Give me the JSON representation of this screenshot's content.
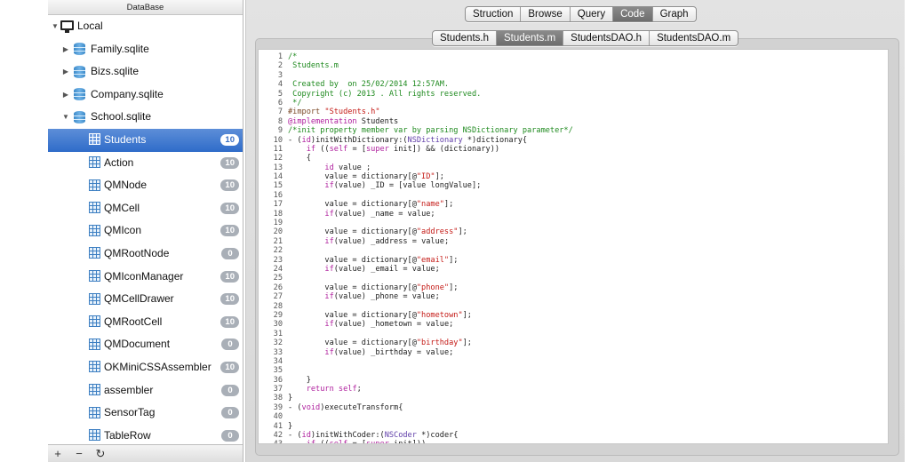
{
  "sidebar": {
    "header": "DataBase",
    "rows": [
      {
        "label": "Local",
        "kind": "monitor",
        "level": 0,
        "disclosure": "open"
      },
      {
        "label": "Family.sqlite",
        "kind": "db",
        "level": 1,
        "disclosure": "closed"
      },
      {
        "label": "Bizs.sqlite",
        "kind": "db",
        "level": 1,
        "disclosure": "closed"
      },
      {
        "label": "Company.sqlite",
        "kind": "db",
        "level": 1,
        "disclosure": "closed"
      },
      {
        "label": "School.sqlite",
        "kind": "db",
        "level": 1,
        "disclosure": "open"
      },
      {
        "label": "Students",
        "kind": "table",
        "level": 2,
        "badge": "10",
        "selected": true
      },
      {
        "label": "Action",
        "kind": "table",
        "level": 2,
        "badge": "10"
      },
      {
        "label": "QMNode",
        "kind": "table",
        "level": 2,
        "badge": "10"
      },
      {
        "label": "QMCell",
        "kind": "table",
        "level": 2,
        "badge": "10"
      },
      {
        "label": "QMIcon",
        "kind": "table",
        "level": 2,
        "badge": "10"
      },
      {
        "label": "QMRootNode",
        "kind": "table",
        "level": 2,
        "badge": "0"
      },
      {
        "label": "QMIconManager",
        "kind": "table",
        "level": 2,
        "badge": "10"
      },
      {
        "label": "QMCellDrawer",
        "kind": "table",
        "level": 2,
        "badge": "10"
      },
      {
        "label": "QMRootCell",
        "kind": "table",
        "level": 2,
        "badge": "10"
      },
      {
        "label": "QMDocument",
        "kind": "table",
        "level": 2,
        "badge": "0"
      },
      {
        "label": "OKMiniCSSAssembler",
        "kind": "table",
        "level": 2,
        "badge": "10"
      },
      {
        "label": "assembler",
        "kind": "table",
        "level": 2,
        "badge": "0"
      },
      {
        "label": "SensorTag",
        "kind": "table",
        "level": 2,
        "badge": "0"
      },
      {
        "label": "TableRow",
        "kind": "table",
        "level": 2,
        "badge": "0"
      }
    ],
    "footer": {
      "add": "+",
      "remove": "−",
      "refresh": "↻"
    }
  },
  "toolbar": {
    "modes": [
      {
        "label": "Struction",
        "active": false
      },
      {
        "label": "Browse",
        "active": false
      },
      {
        "label": "Query",
        "active": false
      },
      {
        "label": "Code",
        "active": true
      },
      {
        "label": "Graph",
        "active": false
      }
    ],
    "files": [
      {
        "label": "Students.h",
        "active": false
      },
      {
        "label": "Students.m",
        "active": true
      },
      {
        "label": "StudentsDAO.h",
        "active": false
      },
      {
        "label": "StudentsDAO.m",
        "active": false
      }
    ]
  },
  "code": {
    "lines": [
      [
        [
          "c",
          "/*"
        ]
      ],
      [
        [
          "c",
          " Students.m"
        ]
      ],
      [
        [
          "c",
          " "
        ]
      ],
      [
        [
          "c",
          " Created by  on 25/02/2014 12:57AM."
        ]
      ],
      [
        [
          "c",
          " Copyright (c) 2013 . All rights reserved."
        ]
      ],
      [
        [
          "c",
          " */"
        ]
      ],
      [
        [
          "p",
          "#import "
        ],
        [
          "s",
          "\"Students.h\""
        ]
      ],
      [
        [
          "k",
          "@implementation"
        ],
        [
          "n",
          " Students"
        ]
      ],
      [
        [
          "c",
          "/*init property member var by parsing NSDictionary parameter*/"
        ]
      ],
      [
        [
          "n",
          "- ("
        ],
        [
          "k",
          "id"
        ],
        [
          "n",
          ")initWithDictionary:("
        ],
        [
          "t",
          "NSDictionary"
        ],
        [
          "n",
          " *)dictionary{"
        ]
      ],
      [
        [
          "n",
          "    "
        ],
        [
          "k",
          "if"
        ],
        [
          "n",
          " (("
        ],
        [
          "k",
          "self"
        ],
        [
          "n",
          " = ["
        ],
        [
          "k",
          "super"
        ],
        [
          "n",
          " init]) && (dictionary))"
        ]
      ],
      [
        [
          "n",
          "    {"
        ]
      ],
      [
        [
          "n",
          "        "
        ],
        [
          "k",
          "id"
        ],
        [
          "n",
          " value ;"
        ]
      ],
      [
        [
          "n",
          "        value = dictionary[@"
        ],
        [
          "s",
          "\"ID\""
        ],
        [
          "n",
          "];"
        ]
      ],
      [
        [
          "n",
          "        "
        ],
        [
          "k",
          "if"
        ],
        [
          "n",
          "(value) _ID = [value longValue];"
        ]
      ],
      [
        [
          "n",
          ""
        ]
      ],
      [
        [
          "n",
          "        value = dictionary[@"
        ],
        [
          "s",
          "\"name\""
        ],
        [
          "n",
          "];"
        ]
      ],
      [
        [
          "n",
          "        "
        ],
        [
          "k",
          "if"
        ],
        [
          "n",
          "(value) _name = value;"
        ]
      ],
      [
        [
          "n",
          ""
        ]
      ],
      [
        [
          "n",
          "        value = dictionary[@"
        ],
        [
          "s",
          "\"address\""
        ],
        [
          "n",
          "];"
        ]
      ],
      [
        [
          "n",
          "        "
        ],
        [
          "k",
          "if"
        ],
        [
          "n",
          "(value) _address = value;"
        ]
      ],
      [
        [
          "n",
          ""
        ]
      ],
      [
        [
          "n",
          "        value = dictionary[@"
        ],
        [
          "s",
          "\"email\""
        ],
        [
          "n",
          "];"
        ]
      ],
      [
        [
          "n",
          "        "
        ],
        [
          "k",
          "if"
        ],
        [
          "n",
          "(value) _email = value;"
        ]
      ],
      [
        [
          "n",
          ""
        ]
      ],
      [
        [
          "n",
          "        value = dictionary[@"
        ],
        [
          "s",
          "\"phone\""
        ],
        [
          "n",
          "];"
        ]
      ],
      [
        [
          "n",
          "        "
        ],
        [
          "k",
          "if"
        ],
        [
          "n",
          "(value) _phone = value;"
        ]
      ],
      [
        [
          "n",
          ""
        ]
      ],
      [
        [
          "n",
          "        value = dictionary[@"
        ],
        [
          "s",
          "\"hometown\""
        ],
        [
          "n",
          "];"
        ]
      ],
      [
        [
          "n",
          "        "
        ],
        [
          "k",
          "if"
        ],
        [
          "n",
          "(value) _hometown = value;"
        ]
      ],
      [
        [
          "n",
          ""
        ]
      ],
      [
        [
          "n",
          "        value = dictionary[@"
        ],
        [
          "s",
          "\"birthday\""
        ],
        [
          "n",
          "];"
        ]
      ],
      [
        [
          "n",
          "        "
        ],
        [
          "k",
          "if"
        ],
        [
          "n",
          "(value) _birthday = value;"
        ]
      ],
      [
        [
          "n",
          ""
        ]
      ],
      [
        [
          "n",
          ""
        ]
      ],
      [
        [
          "n",
          "    }"
        ]
      ],
      [
        [
          "n",
          "    "
        ],
        [
          "k",
          "return self"
        ],
        [
          "n",
          ";"
        ]
      ],
      [
        [
          "n",
          "}"
        ]
      ],
      [
        [
          "n",
          "- ("
        ],
        [
          "k",
          "void"
        ],
        [
          "n",
          ")executeTransform{"
        ]
      ],
      [
        [
          "n",
          ""
        ]
      ],
      [
        [
          "n",
          "}"
        ]
      ],
      [
        [
          "n",
          "- ("
        ],
        [
          "k",
          "id"
        ],
        [
          "n",
          ")initWithCoder:("
        ],
        [
          "t",
          "NSCoder"
        ],
        [
          "n",
          " *)coder{"
        ]
      ],
      [
        [
          "n",
          "    "
        ],
        [
          "k",
          "if"
        ],
        [
          "n",
          " (("
        ],
        [
          "k",
          "self"
        ],
        [
          "n",
          " = ["
        ],
        [
          "k",
          "super"
        ],
        [
          "n",
          " init]))"
        ]
      ]
    ]
  }
}
